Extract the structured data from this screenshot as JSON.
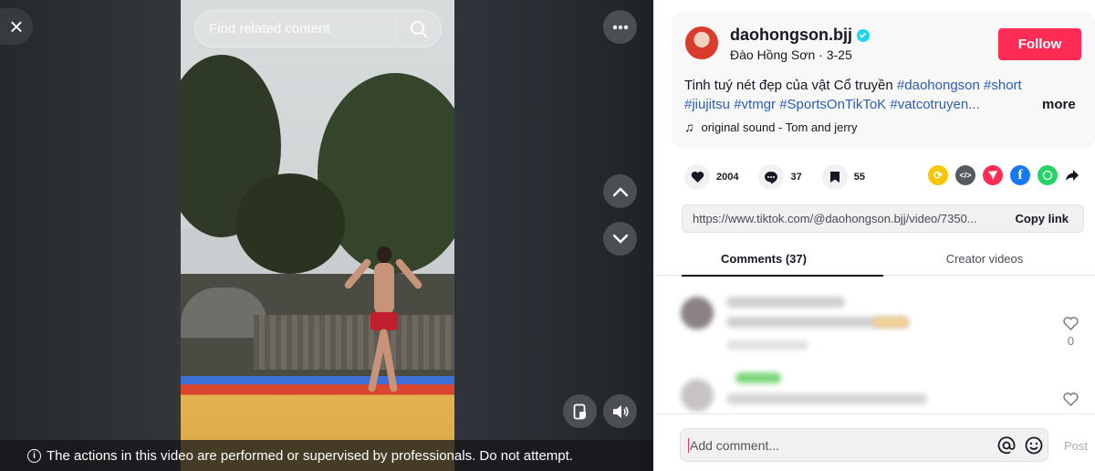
{
  "stage": {
    "close_icon": "×",
    "search_placeholder": "Find related content",
    "notice_text": "The actions in this video are performed or supervised by professionals. Do not attempt."
  },
  "author": {
    "username": "daohongson.bjj",
    "display_name": "Đào Hồng Sơn",
    "date": "3-25",
    "follow_label": "Follow"
  },
  "caption": {
    "text": "Tinh tuý nét đẹp của vật Cổ truyền ",
    "tags_line1": "#daohongson #short",
    "tags_line2": "#jiujitsu #vtmgr #SportsOnTikToK #vatcotruyen...",
    "more_label": "more"
  },
  "sound": {
    "label": "original sound - Tom  and  jerry"
  },
  "stats": {
    "likes": "2004",
    "comments": "37",
    "saves": "55"
  },
  "share_colors": {
    "repost": "#f7c600",
    "embed": "#555a5f",
    "send": "#fe2c55",
    "facebook": "#1877f2",
    "whatsapp": "#25d366"
  },
  "link": {
    "url": "https://www.tiktok.com/@daohongson.bjj/video/7350...",
    "copy_label": "Copy link"
  },
  "tabs": [
    {
      "label": "Comments (37)"
    },
    {
      "label": "Creator videos"
    }
  ],
  "comments": [
    {
      "likes": "0"
    }
  ],
  "comment_input": {
    "placeholder": "Add comment...",
    "post_label": "Post"
  }
}
